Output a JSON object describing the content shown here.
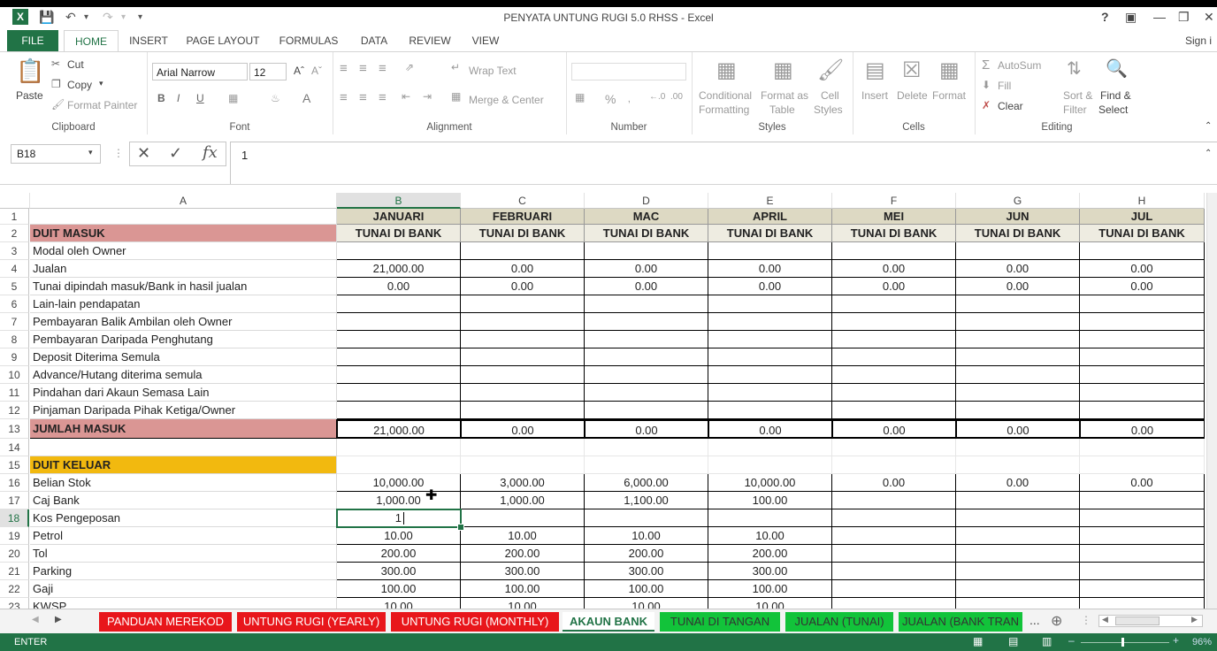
{
  "window": {
    "title": "PENYATA UNTUNG RUGI 5.0 RHSS - Excel",
    "help": "?",
    "sign_in": "Sign i"
  },
  "ribbon_tabs": [
    "FILE",
    "HOME",
    "INSERT",
    "PAGE LAYOUT",
    "FORMULAS",
    "DATA",
    "REVIEW",
    "VIEW"
  ],
  "ribbon": {
    "clipboard": {
      "paste": "Paste",
      "cut": "Cut",
      "copy": "Copy",
      "format_painter": "Format Painter",
      "label": "Clipboard"
    },
    "font": {
      "name": "Arial Narrow",
      "size": "12",
      "label": "Font",
      "bold": "B",
      "italic": "I",
      "underline": "U"
    },
    "alignment": {
      "wrap": "Wrap Text",
      "merge": "Merge & Center",
      "label": "Alignment"
    },
    "number": {
      "label": "Number",
      "percent": "%"
    },
    "styles": {
      "conditional": "Conditional",
      "conditional2": "Formatting",
      "format_as": "Format as",
      "format_as2": "Table",
      "cell": "Cell",
      "cell2": "Styles",
      "label": "Styles"
    },
    "cells": {
      "insert": "Insert",
      "delete": "Delete",
      "format": "Format",
      "label": "Cells"
    },
    "editing": {
      "autosum": "AutoSum",
      "fill": "Fill",
      "clear": "Clear",
      "sort": "Sort &",
      "sort2": "Filter",
      "find": "Find &",
      "find2": "Select",
      "label": "Editing"
    }
  },
  "formula_bar": {
    "name_box": "B18",
    "value": "1",
    "fx": "fx"
  },
  "columns": [
    "A",
    "B",
    "C",
    "D",
    "E",
    "F",
    "G",
    "H"
  ],
  "months": [
    "JANUARI",
    "FEBRUARI",
    "MAC",
    "APRIL",
    "MEI",
    "JUN",
    "JUL"
  ],
  "subheader": "TUNAI DI BANK",
  "rows": [
    {
      "n": "1",
      "a": "",
      "v": []
    },
    {
      "n": "2",
      "a": "DUIT  MASUK",
      "v": []
    },
    {
      "n": "3",
      "a": "Modal oleh Owner",
      "v": [
        "",
        "",
        "",
        "",
        "",
        "",
        ""
      ]
    },
    {
      "n": "4",
      "a": "Jualan",
      "v": [
        "21,000.00",
        "0.00",
        "0.00",
        "0.00",
        "0.00",
        "0.00",
        "0.00"
      ]
    },
    {
      "n": "5",
      "a": "Tunai dipindah masuk/Bank in hasil jualan",
      "v": [
        "0.00",
        "0.00",
        "0.00",
        "0.00",
        "0.00",
        "0.00",
        "0.00"
      ]
    },
    {
      "n": "6",
      "a": "Lain-lain pendapatan",
      "v": [
        "",
        "",
        "",
        "",
        "",
        "",
        ""
      ]
    },
    {
      "n": "7",
      "a": "Pembayaran Balik Ambilan oleh Owner",
      "v": [
        "",
        "",
        "",
        "",
        "",
        "",
        ""
      ]
    },
    {
      "n": "8",
      "a": "Pembayaran Daripada Penghutang",
      "v": [
        "",
        "",
        "",
        "",
        "",
        "",
        ""
      ]
    },
    {
      "n": "9",
      "a": "Deposit Diterima Semula",
      "v": [
        "",
        "",
        "",
        "",
        "",
        "",
        ""
      ]
    },
    {
      "n": "10",
      "a": "Advance/Hutang diterima semula",
      "v": [
        "",
        "",
        "",
        "",
        "",
        "",
        ""
      ]
    },
    {
      "n": "11",
      "a": "Pindahan dari Akaun Semasa Lain",
      "v": [
        "",
        "",
        "",
        "",
        "",
        "",
        ""
      ]
    },
    {
      "n": "12",
      "a": "Pinjaman Daripada Pihak Ketiga/Owner",
      "v": [
        "",
        "",
        "",
        "",
        "",
        "",
        ""
      ]
    },
    {
      "n": "13",
      "a": "JUMLAH MASUK",
      "v": [
        "21,000.00",
        "0.00",
        "0.00",
        "0.00",
        "0.00",
        "0.00",
        "0.00"
      ]
    },
    {
      "n": "14",
      "a": "",
      "v": []
    },
    {
      "n": "15",
      "a": "DUIT KELUAR",
      "v": []
    },
    {
      "n": "16",
      "a": "Belian Stok",
      "v": [
        "10,000.00",
        "3,000.00",
        "6,000.00",
        "10,000.00",
        "0.00",
        "0.00",
        "0.00"
      ]
    },
    {
      "n": "17",
      "a": "Caj Bank",
      "v": [
        "1,000.00",
        "1,000.00",
        "1,100.00",
        "100.00",
        "",
        "",
        ""
      ]
    },
    {
      "n": "18",
      "a": "Kos Pengeposan",
      "v": [
        "1",
        "",
        "",
        "",
        "",
        "",
        ""
      ]
    },
    {
      "n": "19",
      "a": "Petrol",
      "v": [
        "10.00",
        "10.00",
        "10.00",
        "10.00",
        "",
        "",
        ""
      ]
    },
    {
      "n": "20",
      "a": "Tol",
      "v": [
        "200.00",
        "200.00",
        "200.00",
        "200.00",
        "",
        "",
        ""
      ]
    },
    {
      "n": "21",
      "a": "Parking",
      "v": [
        "300.00",
        "300.00",
        "300.00",
        "300.00",
        "",
        "",
        ""
      ]
    },
    {
      "n": "22",
      "a": "Gaji",
      "v": [
        "100.00",
        "100.00",
        "100.00",
        "100.00",
        "",
        "",
        ""
      ]
    },
    {
      "n": "23",
      "a": "KWSP",
      "v": [
        "10.00",
        "10.00",
        "10.00",
        "10.00",
        "",
        "",
        ""
      ]
    }
  ],
  "sheet_tabs": [
    {
      "label": "PANDUAN MEREKOD",
      "style": "red"
    },
    {
      "label": "UNTUNG RUGI (YEARLY)",
      "style": "red"
    },
    {
      "label": "UNTUNG RUGI (MONTHLY)",
      "style": "red"
    },
    {
      "label": "AKAUN BANK",
      "style": "active"
    },
    {
      "label": "TUNAI DI TANGAN",
      "style": "green"
    },
    {
      "label": "JUALAN (TUNAI)",
      "style": "green"
    },
    {
      "label": "JUALAN (BANK TRAN",
      "style": "green"
    }
  ],
  "sheet_more": "...",
  "status": {
    "mode": "ENTER",
    "zoom": "96%"
  },
  "colors": {
    "excel_green": "#217346",
    "header_band": "#ddd9c3",
    "pink": "#da9694",
    "orange": "#f2b90f",
    "red_tab": "#e8161b",
    "green_tab": "#12c33a"
  }
}
